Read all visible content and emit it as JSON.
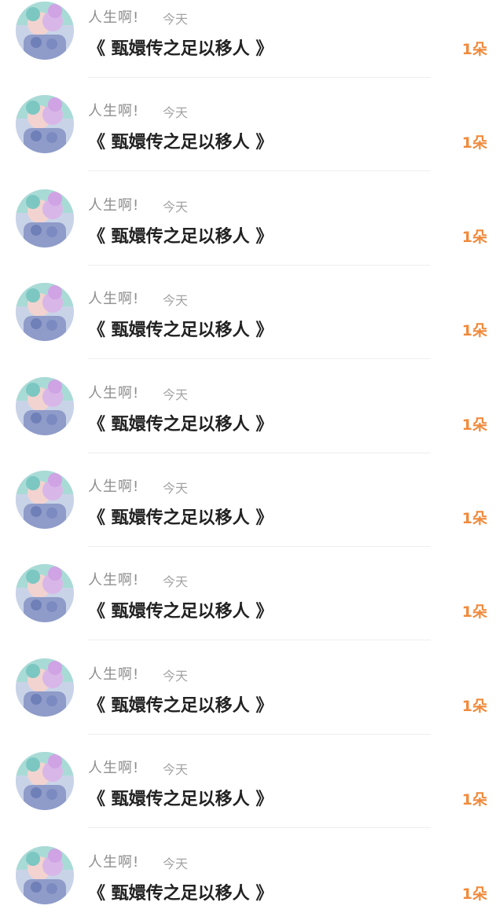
{
  "colors": {
    "count_accent": "#f08a3c",
    "username": "#8e8e8e",
    "title": "#222222"
  },
  "items": [
    {
      "username": "人生啊!",
      "time": "今天",
      "title": "《 甄嬛传之足以移人 》",
      "count": "1朵",
      "avatar_icon": "avatar-image"
    },
    {
      "username": "人生啊!",
      "time": "今天",
      "title": "《 甄嬛传之足以移人 》",
      "count": "1朵",
      "avatar_icon": "avatar-image"
    },
    {
      "username": "人生啊!",
      "time": "今天",
      "title": "《 甄嬛传之足以移人 》",
      "count": "1朵",
      "avatar_icon": "avatar-image"
    },
    {
      "username": "人生啊!",
      "time": "今天",
      "title": "《 甄嬛传之足以移人 》",
      "count": "1朵",
      "avatar_icon": "avatar-image"
    },
    {
      "username": "人生啊!",
      "time": "今天",
      "title": "《 甄嬛传之足以移人 》",
      "count": "1朵",
      "avatar_icon": "avatar-image"
    },
    {
      "username": "人生啊!",
      "time": "今天",
      "title": "《 甄嬛传之足以移人 》",
      "count": "1朵",
      "avatar_icon": "avatar-image"
    },
    {
      "username": "人生啊!",
      "time": "今天",
      "title": "《 甄嬛传之足以移人 》",
      "count": "1朵",
      "avatar_icon": "avatar-image"
    },
    {
      "username": "人生啊!",
      "time": "今天",
      "title": "《 甄嬛传之足以移人 》",
      "count": "1朵",
      "avatar_icon": "avatar-image"
    },
    {
      "username": "人生啊!",
      "time": "今天",
      "title": "《 甄嬛传之足以移人 》",
      "count": "1朵",
      "avatar_icon": "avatar-image"
    },
    {
      "username": "人生啊!",
      "time": "今天",
      "title": "《 甄嬛传之足以移人 》",
      "count": "1朵",
      "avatar_icon": "avatar-image"
    }
  ]
}
